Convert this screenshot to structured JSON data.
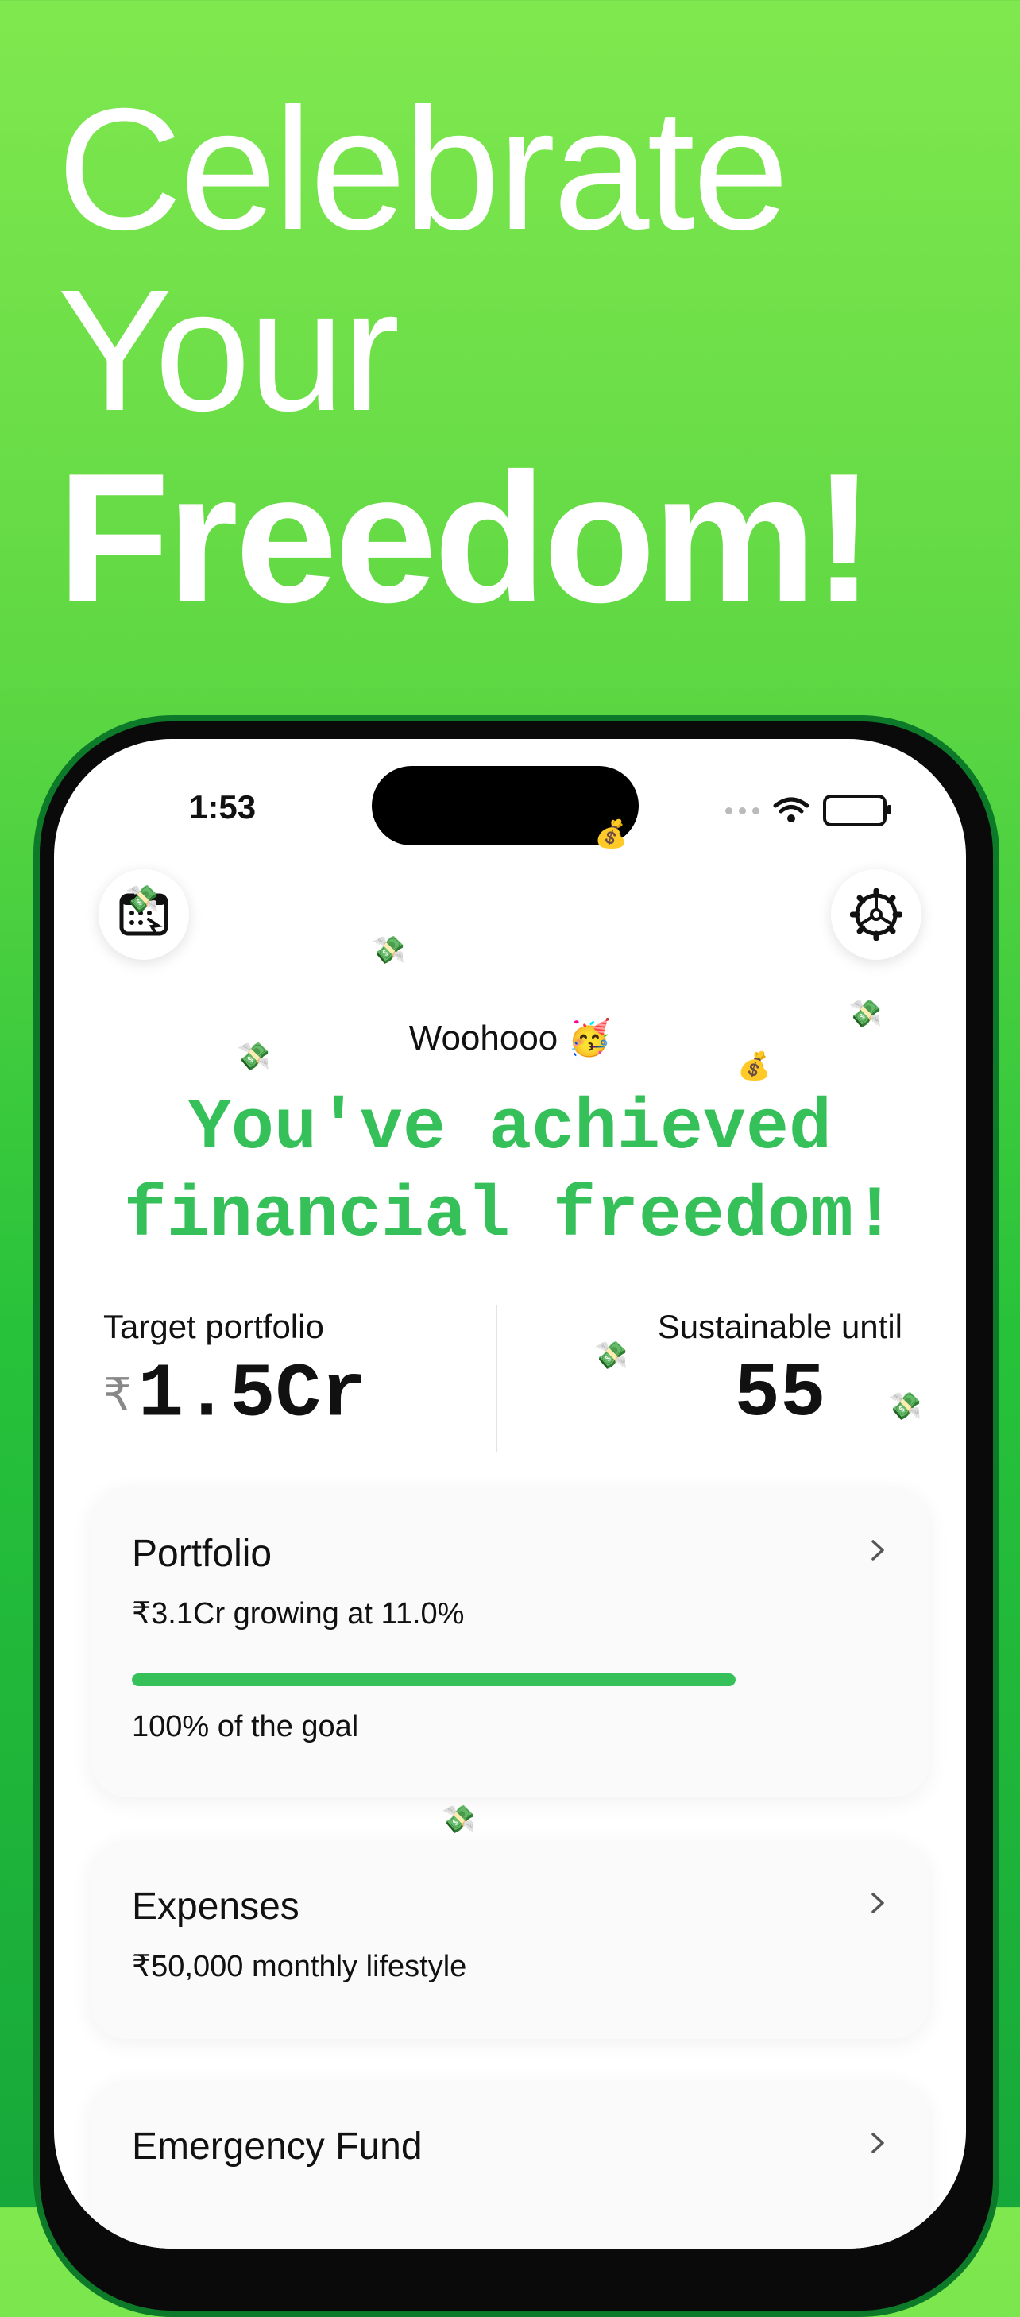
{
  "headline": {
    "line1": "Celebrate",
    "line2": "Your",
    "line3": "Freedom!"
  },
  "status_bar": {
    "time": "1:53"
  },
  "header": {
    "calendar_icon": "calendar-icon",
    "settings_icon": "gear-icon"
  },
  "celebration": {
    "greeting": "Woohooo 🥳",
    "message": "You've achieved financial freedom!"
  },
  "stats": {
    "target_label": "Target portfolio",
    "currency_symbol": "₹",
    "target_value": "1.5Cr",
    "sustainable_label": "Sustainable until",
    "sustainable_value": "55"
  },
  "cards": {
    "portfolio": {
      "title": "Portfolio",
      "subtitle": "₹3.1Cr growing at 11.0%",
      "progress_label": "100% of the goal",
      "progress_fraction": 1.0
    },
    "expenses": {
      "title": "Expenses",
      "subtitle": "₹50,000 monthly lifestyle"
    },
    "emergency": {
      "title": "Emergency Fund"
    }
  },
  "colors": {
    "accent": "#36c05a",
    "background_top": "#80e84f",
    "background_bottom": "#16a83a"
  }
}
